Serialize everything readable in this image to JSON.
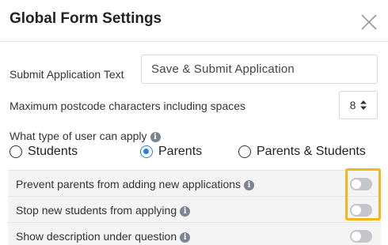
{
  "modal": {
    "title": "Global Form Settings",
    "close_icon": "close-icon"
  },
  "fields": {
    "submit_text": {
      "label": "Submit Application Text",
      "value": "Save & Submit Application"
    },
    "postcode_max": {
      "label": "Maximum postcode characters including spaces",
      "value": "8"
    },
    "user_type": {
      "label": "What type of user can apply",
      "options": [
        {
          "label": "Students",
          "checked": false
        },
        {
          "label": "Parents",
          "checked": true
        },
        {
          "label": "Parents & Students",
          "checked": false
        }
      ]
    }
  },
  "settings": [
    {
      "label": "Prevent parents from adding new applications",
      "enabled": false,
      "has_info": true
    },
    {
      "label": "Stop new students from applying",
      "enabled": false,
      "has_info": true
    },
    {
      "label": "Show description under question",
      "enabled": false,
      "has_info": true
    }
  ],
  "colors": {
    "accent": "#2c7be5",
    "highlight": "#f2b51c",
    "toggle_off": "#c3c7cc",
    "row_background": "#f4f4f4"
  }
}
